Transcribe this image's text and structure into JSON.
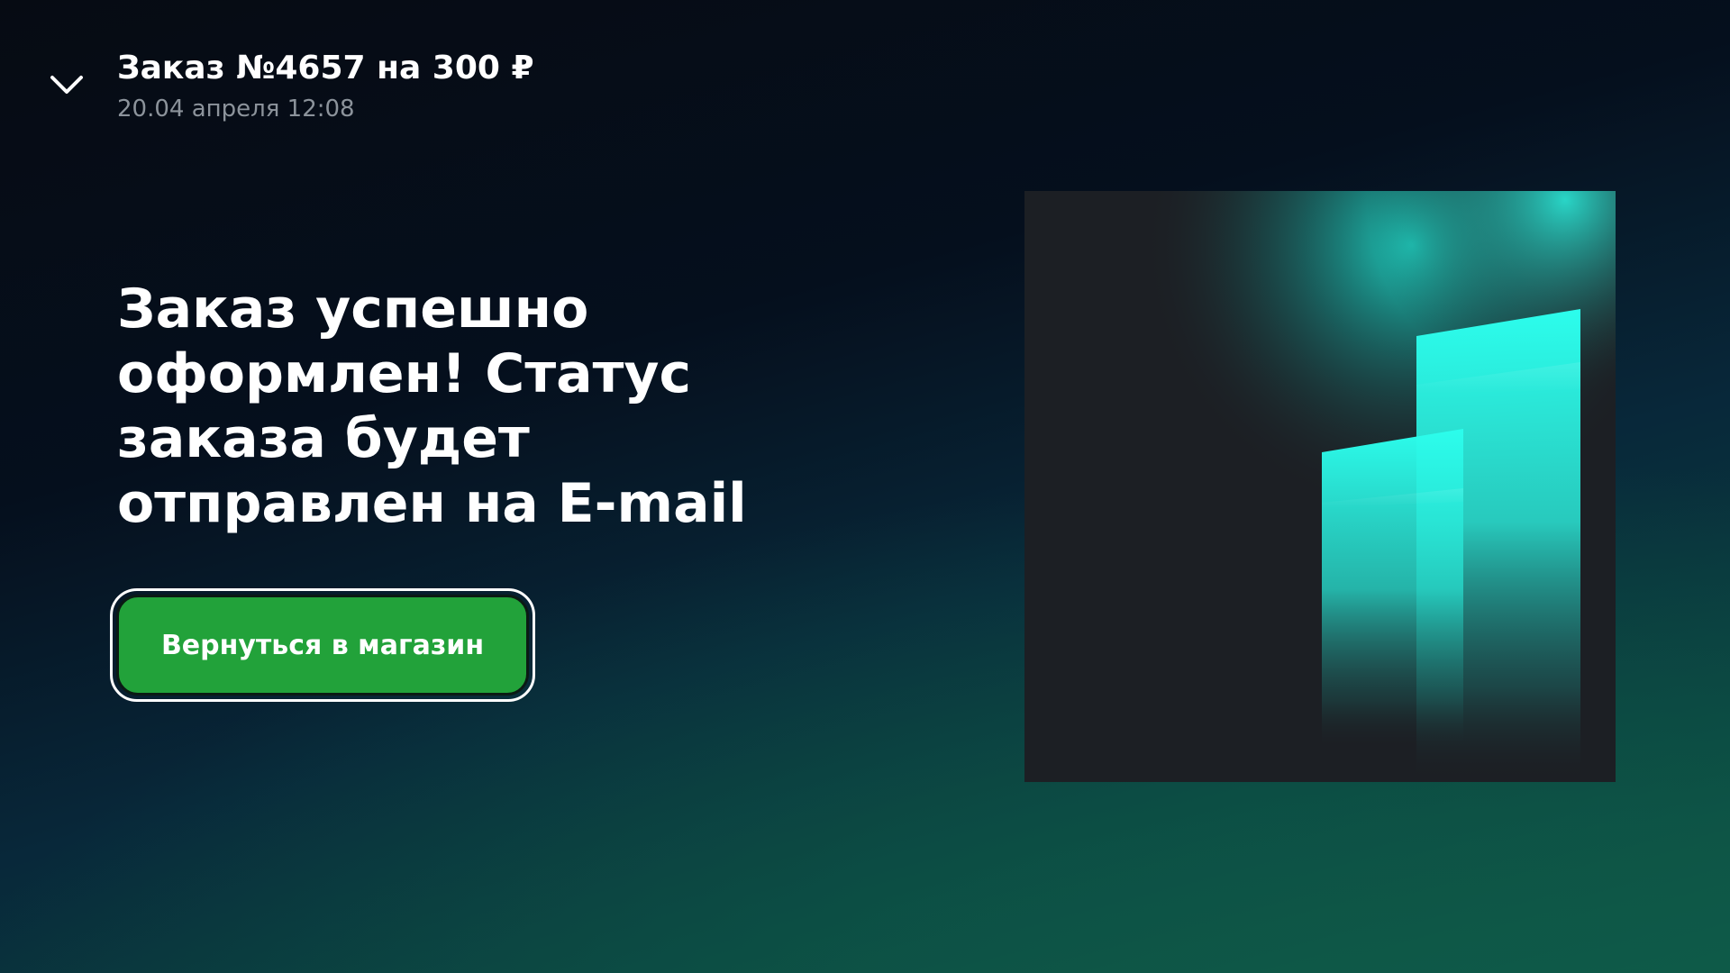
{
  "order": {
    "title": "Заказ №4657 на 300 ₽",
    "date": "20.04 апреля 12:08"
  },
  "icons": {
    "toggle": "chevron-down-icon",
    "illustration": "glowing-columns-illustration"
  },
  "message": {
    "heading": "Заказ успешно оформлен! Статус заказа будет отправлен на E-mail"
  },
  "actions": {
    "back_to_shop_label": "Вернуться в магазин"
  },
  "colors": {
    "button_green": "#22a23a",
    "accent_cyan": "#2af3e3",
    "background_dark": "#050f1d",
    "background_teal": "#105a48",
    "muted_text": "#8c939b"
  }
}
